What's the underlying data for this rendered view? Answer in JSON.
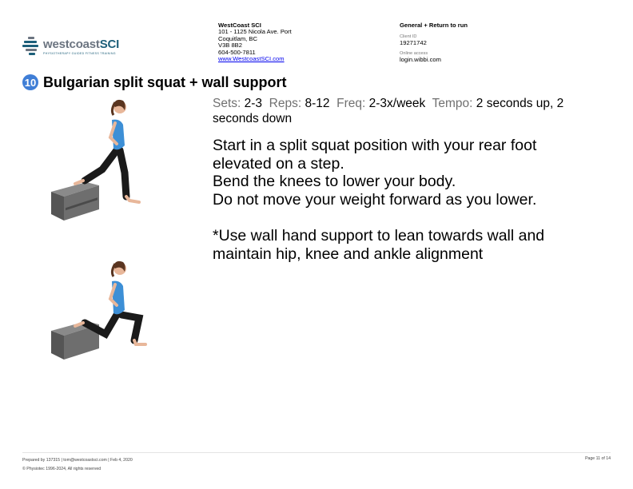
{
  "brand": {
    "logo_word_a": "westcoast",
    "logo_word_b": "SCI",
    "logo_tagline": "PHYSIOTHERAPY GUIDED FITNESS TRAINING",
    "colors": {
      "grey": "#6b7480",
      "teal": "#1d5f7a",
      "accent": "#3f7ed6"
    }
  },
  "clinic": {
    "name": "WestCoast SCI",
    "address_line1": "101 - 1125 Nicola Ave. Port",
    "address_line2": "Coquitlam, BC",
    "postal": "V3B 8B2",
    "phone": "604-500-7811",
    "website": "www.WestcoastSCI.com"
  },
  "program": {
    "title": "General + Return to run",
    "client_id_label": "Client ID",
    "client_id": "19271742",
    "online_label": "Online access",
    "online_value": "login.wibbi.com"
  },
  "exercise": {
    "number": "10",
    "title": "Bulgarian split squat + wall support",
    "params": {
      "sets_label": "Sets:",
      "sets": "2-3",
      "reps_label": "Reps:",
      "reps": "8-12",
      "freq_label": "Freq:",
      "freq": "2-3x/week",
      "tempo_label": "Tempo:",
      "tempo": "2 seconds up, 2 seconds down"
    },
    "description": [
      "Start in a split squat position with your rear foot",
      "elevated on a step.",
      "Bend the knees to lower your body.",
      "Do not move your weight forward as you lower.",
      "",
      "*Use wall hand support to lean towards wall and",
      "maintain hip, knee and ankle alignment"
    ]
  },
  "footer": {
    "prepared_by": "Prepared by 137315 | tom@westcoastsci.com | Feb 4, 2020",
    "copyright": "© Physiotec 1996-2024, All rights reserved",
    "page": "Page 11 of 14"
  }
}
